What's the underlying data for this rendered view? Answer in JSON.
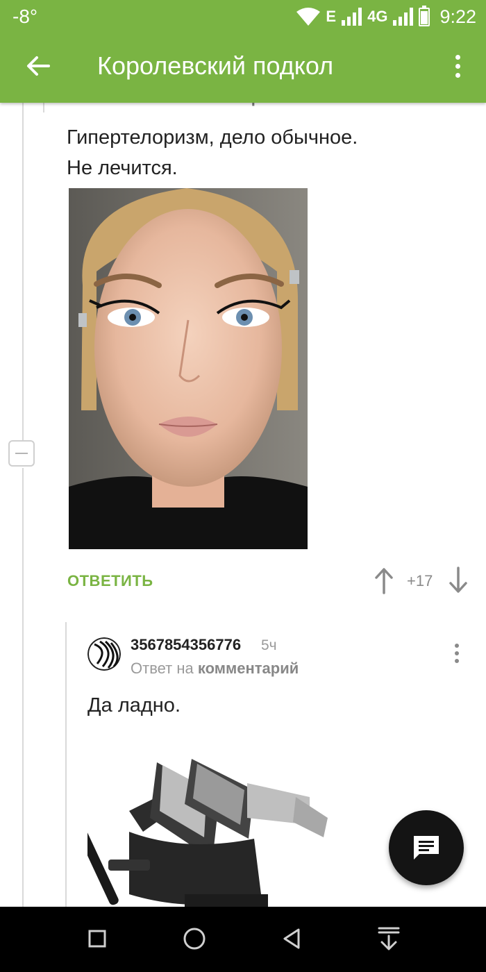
{
  "status_bar": {
    "temperature": "-8°",
    "network_e": "E",
    "network_4g": "4G",
    "time": "9:22"
  },
  "app_bar": {
    "title": "Королевский подкол"
  },
  "thread": {
    "hidden_snippet": {
      "prefix": "Ответ на",
      "link": "комментарий"
    },
    "comment": {
      "line1": "Гипертелоризм, дело обычное.",
      "line2": "Не лечится.",
      "reply_label": "ОТВЕТИТЬ",
      "rating": "+17"
    },
    "reply": {
      "author": "3567854356776",
      "time": "5ч",
      "sub_prefix": "Ответ на",
      "sub_link": "комментарий",
      "text": "Да ладно."
    }
  },
  "icons": {
    "back": "arrow-left-icon",
    "menu": "more-vert-icon",
    "collapse": "minus-square-icon",
    "upvote": "arrow-up-icon",
    "downvote": "arrow-down-icon",
    "fab": "comment-icon",
    "nav": [
      "recents-square-icon",
      "home-circle-icon",
      "back-triangle-icon",
      "notification-drawer-icon"
    ]
  },
  "colors": {
    "brand_green": "#7ab443",
    "text": "#222222",
    "muted": "#9a9a9a",
    "fab": "#141414"
  }
}
